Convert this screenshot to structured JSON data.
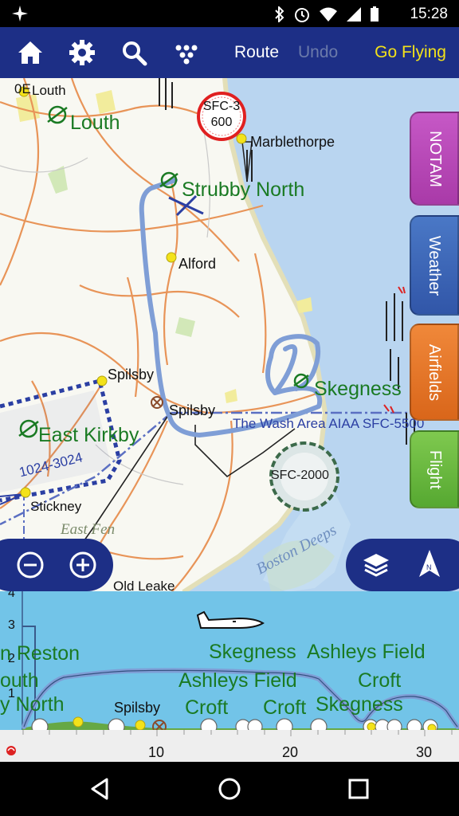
{
  "status_bar": {
    "time": "15:28",
    "icons": [
      "bluetooth-icon",
      "alarm-icon",
      "wifi-icon",
      "signal-icon",
      "battery-icon"
    ]
  },
  "toolbar": {
    "icons": [
      "home-icon",
      "gear-icon",
      "search-icon",
      "more-icon"
    ],
    "route_label": "Route",
    "undo_label": "Undo",
    "go_flying_label": "Go Flying"
  },
  "map": {
    "labels": {
      "corner": "0E",
      "louth_small": "Louth",
      "louth_airfield": "Louth",
      "sfc_circle_line1": "SFC-3",
      "sfc_circle_line2": "600",
      "marblethorpe": "Marblethorpe",
      "strubby_north": "Strubby North",
      "alford": "Alford",
      "spilsby_town": "Spilsby",
      "spilsby_airfield": "Spilsby",
      "skegness": "Skegness",
      "wash_area": "The Wash Area AIAA SFC-5500",
      "east_kirkby": "East Kirkby",
      "airspace_band": "1024-3024",
      "stickney": "Stickney",
      "east_fen": "East Fen",
      "sfc_2000": "SFC-2000",
      "old_leake": "Old Leake",
      "boston_deeps": "Boston Deeps"
    },
    "side_tabs": [
      "NOTAM",
      "Weather",
      "Airfields",
      "Flight"
    ],
    "colors": {
      "route": "#7f9ed6",
      "toolbar": "#1d2f86",
      "sea": "#b9d5f0",
      "airspace": "#2b3fa3"
    }
  },
  "map_controls": {
    "zoom_out_icon": "zoom-out-icon",
    "zoom_in_icon": "zoom-in-icon",
    "layers_icon": "layers-icon",
    "north_icon": "north-arrow-icon"
  },
  "profile": {
    "y_ticks": [
      "4",
      "3",
      "2",
      "1"
    ],
    "x_ticks": [
      "10",
      "20",
      "30"
    ],
    "labels": {
      "reston": "n Reston",
      "louth": "outh",
      "strubby_north": "y North",
      "spilsby": "Spilsby",
      "skegness_top": "Skegness",
      "ashleys_field_top": "Ashleys Field",
      "ashleys_field_mid": "Ashleys Field",
      "croft_right": "Croft",
      "croft_left": "Croft",
      "croft_mid": "Croft",
      "skegness_bottom": "Skegness"
    }
  },
  "nav_bar": {
    "icons": [
      "back-icon",
      "home-circle-icon",
      "recents-icon"
    ]
  }
}
